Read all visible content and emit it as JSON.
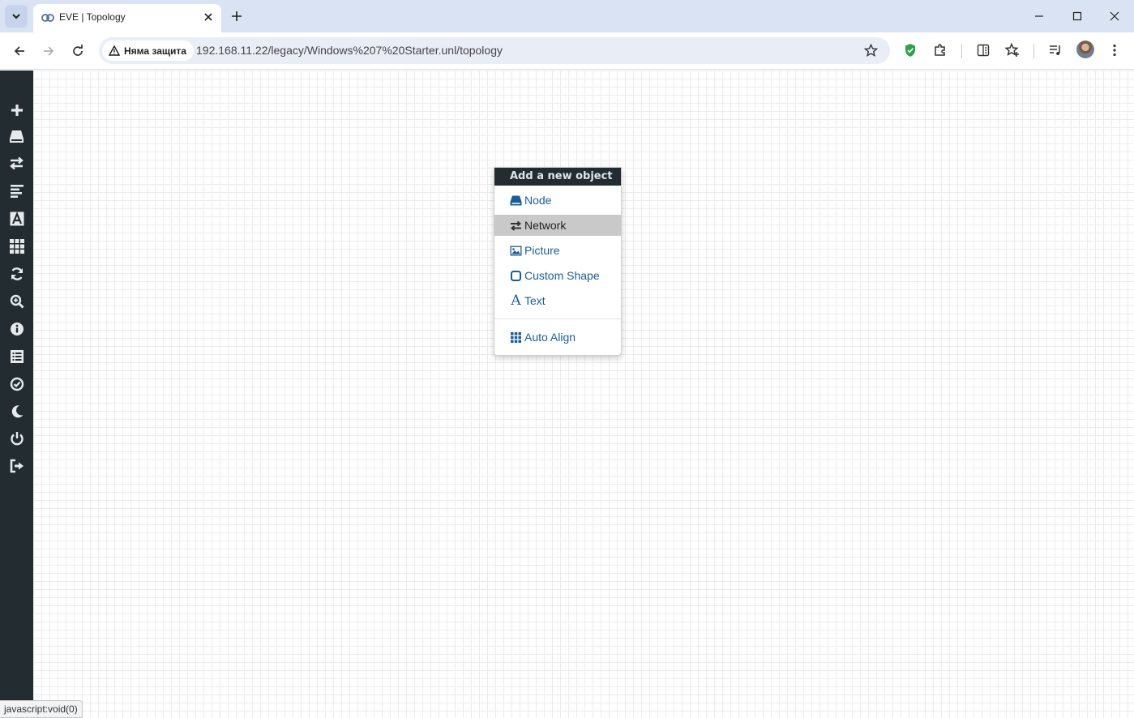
{
  "browser": {
    "tab_title": "EVE | Topology",
    "security_label": "Няма защита",
    "url": "192.168.11.22/legacy/Windows%207%20Starter.unl/topology",
    "status_text": "javascript:void(0)"
  },
  "sidebar": {
    "items": [
      {
        "icon": "plus-icon",
        "label": "Add an object"
      },
      {
        "icon": "nodes-icon",
        "label": "Nodes"
      },
      {
        "icon": "networks-icon",
        "label": "Networks"
      },
      {
        "icon": "startup-configs-icon",
        "label": "Startup-configs"
      },
      {
        "icon": "text-icon",
        "label": "Text"
      },
      {
        "icon": "grid-icon",
        "label": "Grid"
      },
      {
        "icon": "refresh-icon",
        "label": "Refresh"
      },
      {
        "icon": "zoom-icon",
        "label": "Zoom"
      },
      {
        "icon": "info-icon",
        "label": "Lab details"
      },
      {
        "icon": "list-icon",
        "label": "Lab notes"
      },
      {
        "icon": "check-icon",
        "label": "Status"
      },
      {
        "icon": "moon-icon",
        "label": "Dark mode"
      },
      {
        "icon": "power-icon",
        "label": "Close lab"
      },
      {
        "icon": "logout-icon",
        "label": "Logout"
      }
    ]
  },
  "menu": {
    "title": "Add a new object",
    "items": [
      {
        "label": "Node",
        "icon": "node-icon"
      },
      {
        "label": "Network",
        "icon": "network-icon"
      },
      {
        "label": "Picture",
        "icon": "picture-icon"
      },
      {
        "label": "Custom Shape",
        "icon": "custom-shape-icon"
      },
      {
        "label": "Text",
        "icon": "text-a-icon"
      },
      {
        "label": "Auto Align",
        "icon": "auto-align-icon"
      }
    ],
    "highlighted_item": "Network"
  },
  "colors": {
    "sidebar_bg": "#222c31",
    "menu_link": "#1a5c9b",
    "tab_strip": "#dae3f3"
  }
}
